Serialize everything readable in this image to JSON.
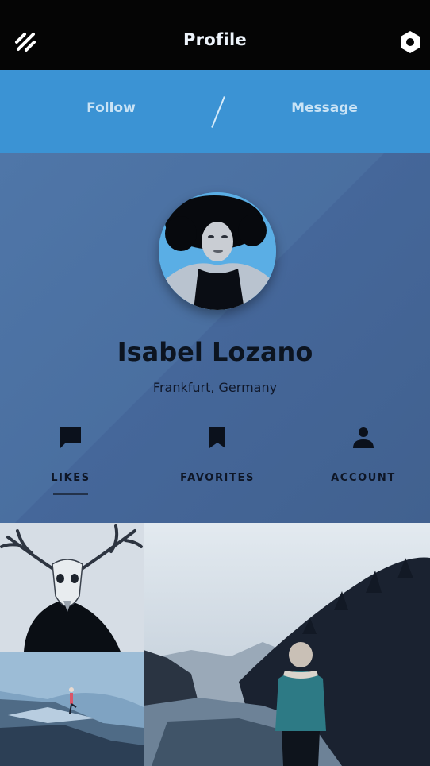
{
  "app": {
    "title": "Profile",
    "menu_icon": "menu-icon",
    "settings_icon": "gear-icon"
  },
  "actions": {
    "follow_label": "Follow",
    "message_label": "Message"
  },
  "profile": {
    "name": "Isabel Lozano",
    "location": "Frankfurt, Germany"
  },
  "tabs": [
    {
      "label": "LIKES",
      "icon": "chat-bubble-icon",
      "selected": true
    },
    {
      "label": "FAVORITES",
      "icon": "bookmark-icon",
      "selected": false
    },
    {
      "label": "ACCOUNT",
      "icon": "person-icon",
      "selected": false
    }
  ],
  "colors": {
    "top_bar": "#050505",
    "action_bar": "#3b93d4",
    "header": "#4a6fa0",
    "text_dark": "#0c1420"
  },
  "photos": [
    {
      "subject": "deer-skull-portrait"
    },
    {
      "subject": "lake-forest-hiker"
    },
    {
      "subject": "rock-yoga-pose"
    }
  ]
}
